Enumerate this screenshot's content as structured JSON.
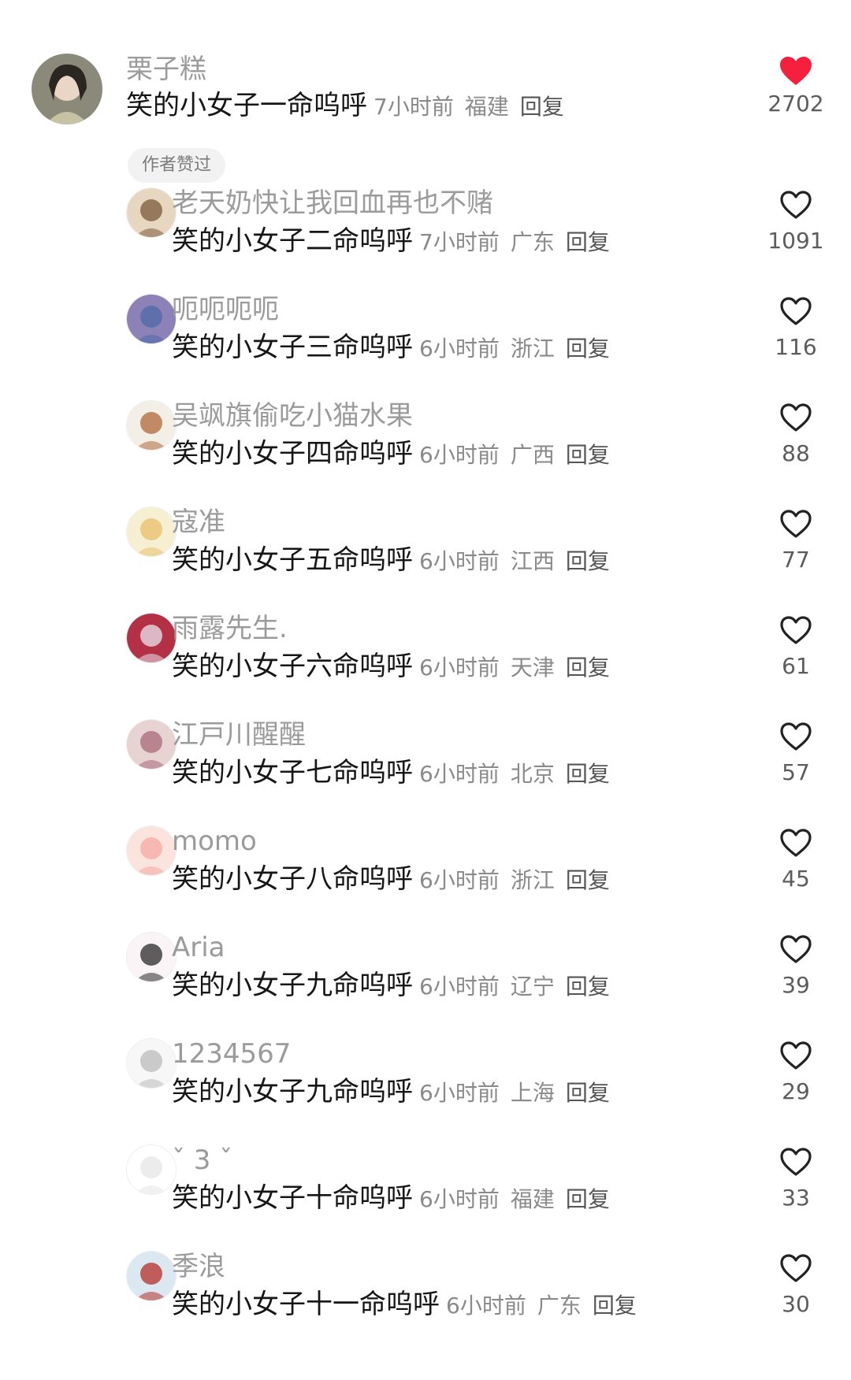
{
  "comments": [
    {
      "username": "栗子糕",
      "content": "笑的小女子一命呜呼",
      "time": "7小时前",
      "location": "福建",
      "reply": "回复",
      "likes": "2702",
      "liked": true,
      "badge": "作者赞过"
    },
    {
      "username": "老天奶快让我回血再也不赌",
      "content": "笑的小女子二命呜呼",
      "time": "7小时前",
      "location": "广东",
      "reply": "回复",
      "likes": "1091",
      "liked": false
    },
    {
      "username": "呃呃呃呃",
      "content": "笑的小女子三命呜呼",
      "time": "6小时前",
      "location": "浙江",
      "reply": "回复",
      "likes": "116",
      "liked": false
    },
    {
      "username": "吴飒旗偷吃小猫水果",
      "content": "笑的小女子四命呜呼",
      "time": "6小时前",
      "location": "广西",
      "reply": "回复",
      "likes": "88",
      "liked": false
    },
    {
      "username": "寇准",
      "content": "笑的小女子五命呜呼",
      "time": "6小时前",
      "location": "江西",
      "reply": "回复",
      "likes": "77",
      "liked": false
    },
    {
      "username": "雨露先生.",
      "content": "笑的小女子六命呜呼",
      "time": "6小时前",
      "location": "天津",
      "reply": "回复",
      "likes": "61",
      "liked": false
    },
    {
      "username": "江戸川醒醒",
      "content": "笑的小女子七命呜呼",
      "time": "6小时前",
      "location": "北京",
      "reply": "回复",
      "likes": "57",
      "liked": false
    },
    {
      "username": "momo",
      "content": "笑的小女子八命呜呼",
      "time": "6小时前",
      "location": "浙江",
      "reply": "回复",
      "likes": "45",
      "liked": false
    },
    {
      "username": "Aria",
      "content": "笑的小女子九命呜呼",
      "time": "6小时前",
      "location": "辽宁",
      "reply": "回复",
      "likes": "39",
      "liked": false
    },
    {
      "username": "1234567",
      "content": "笑的小女子九命呜呼",
      "time": "6小时前",
      "location": "上海",
      "reply": "回复",
      "likes": "29",
      "liked": false
    },
    {
      "username": "ˇ 3 ˇ",
      "content": "笑的小女子十命呜呼",
      "time": "6小时前",
      "location": "福建",
      "reply": "回复",
      "likes": "33",
      "liked": false
    },
    {
      "username": "季浪",
      "content": "笑的小女子十一命呜呼",
      "time": "6小时前",
      "location": "广东",
      "reply": "回复",
      "likes": "30",
      "liked": false
    }
  ],
  "colors": {
    "like_active": "#f5203d",
    "like_inactive": "#222222",
    "username": "#9b9b9b",
    "meta": "#8a8a8a"
  },
  "icons": {
    "like_active": "heart-filled-icon",
    "like_inactive": "heart-outline-icon"
  }
}
